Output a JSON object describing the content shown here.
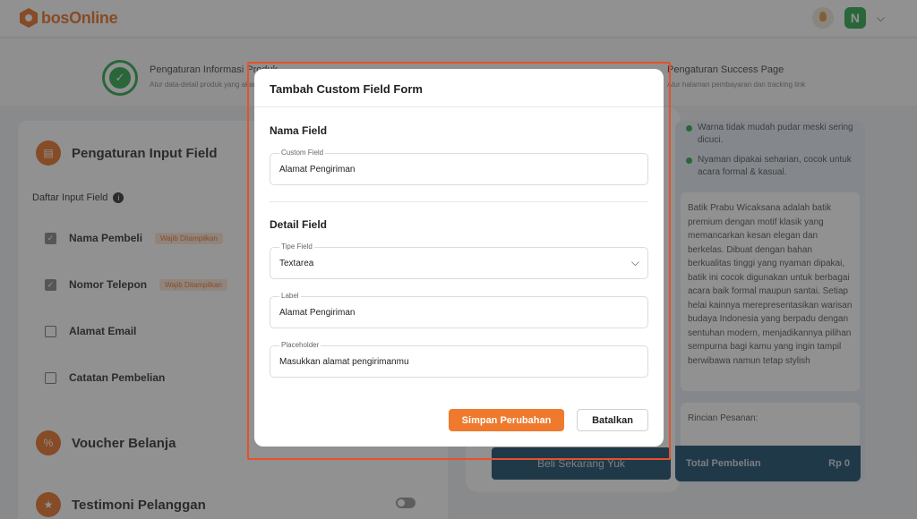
{
  "header": {
    "brand_prefix": "bos",
    "brand_suffix": "Online",
    "user_initial": "N",
    "menu_chevron": "⌵"
  },
  "steps": {
    "step1_title": "Pengaturan Informasi Produk",
    "step1_sub": "Atur data-detail produk yang akan ditampilkan",
    "step3_title": "Pengaturan Success Page",
    "step3_sub": "Atur halaman pembayaran dan tracking link"
  },
  "left_panel": {
    "input_field_title": "Pengaturan Input Field",
    "daftar_label": "Daftar Input Field",
    "fields": [
      {
        "name": "Nama Pembeli",
        "tag": "Wajib Ditampilkan",
        "checked": true
      },
      {
        "name": "Nomor Telepon",
        "tag": "Wajib Ditampilkan",
        "checked": true
      },
      {
        "name": "Alamat Email",
        "tag": "",
        "checked": false
      },
      {
        "name": "Catatan Pembelian",
        "tag": "",
        "checked": false
      }
    ],
    "voucher_title": "Voucher Belanja",
    "testimoni_title": "Testimoni Pelanggan"
  },
  "preview": {
    "buy_button": "Beli Sekarang Yuk",
    "bullets": [
      "Warna tidak mudah pudar meski sering dicuci.",
      "Nyaman dipakai seharian, cocok untuk acara formal & kasual."
    ],
    "description": "Batik Prabu Wicaksana adalah batik premium dengan motif klasik yang memancarkan kesan elegan dan berkelas. Dibuat dengan bahan berkualitas tinggi yang nyaman dipakai, batik ini cocok digunakan untuk berbagai acara baik formal maupun santai. Setiap helai kainnya merepresentasikan warisan budaya Indonesia yang berpadu dengan sentuhan modern, menjadikannya pilihan sempurna bagi kamu yang ingin tampil berwibawa namun tetap stylish",
    "rincian_label": "Rincian Pesanan:",
    "total_label": "Total Pembelian",
    "total_value": "Rp 0"
  },
  "modal": {
    "title": "Tambah Custom Field Form",
    "section_name": "Nama Field",
    "custom_field_label": "Custom Field",
    "custom_field_value": "Alamat Pengiriman",
    "section_detail": "Detail Field",
    "tipe_label": "Tipe Field",
    "tipe_value": "Textarea",
    "label_label": "Label",
    "label_value": "Alamat Pengiriman",
    "placeholder_label": "Placeholder",
    "placeholder_value": "Masukkan alamat pengirimanmu",
    "save_button": "Simpan Perubahan",
    "cancel_button": "Batalkan"
  },
  "colors": {
    "brand_orange": "#EF7A2D",
    "success_green": "#2FA84F",
    "navy": "#1D4E6E",
    "highlight_red": "#E8502A"
  }
}
